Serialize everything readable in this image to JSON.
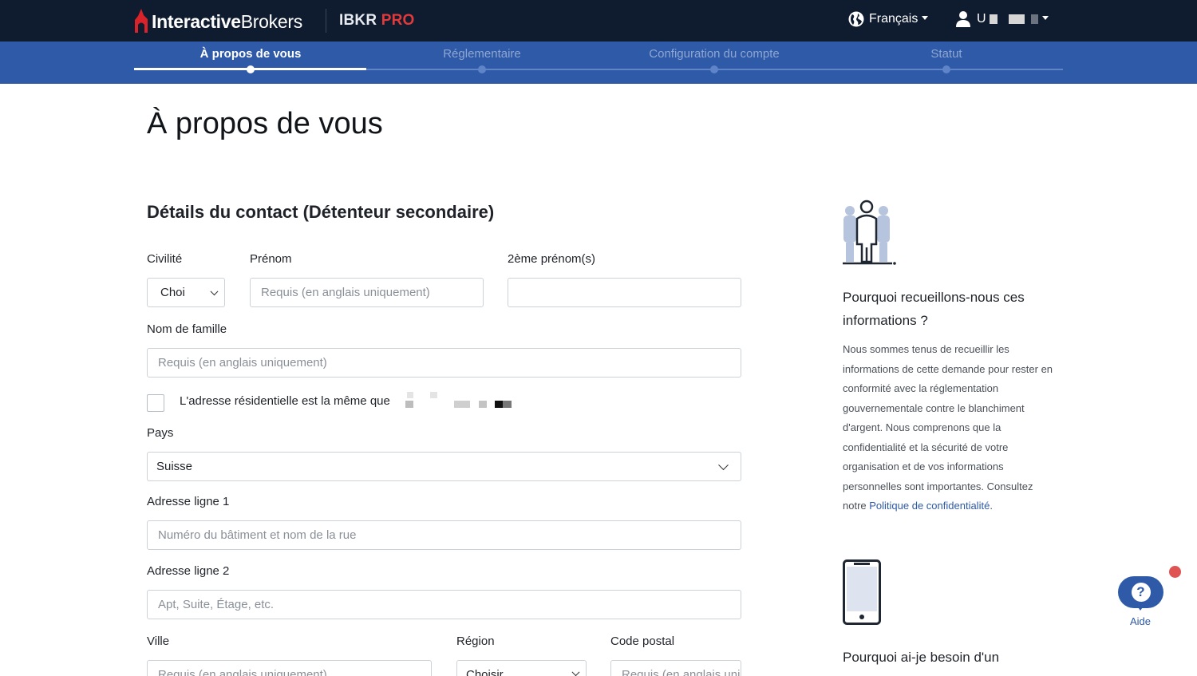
{
  "header": {
    "brand_bold": "Interactive",
    "brand_light": "Brokers",
    "product_name": "IBKR",
    "product_tier": "PRO",
    "language": "Français",
    "user_initial": "U"
  },
  "steps": [
    {
      "label": "À propos de vous",
      "active": true
    },
    {
      "label": "Réglementaire",
      "active": false
    },
    {
      "label": "Configuration du compte",
      "active": false
    },
    {
      "label": "Statut",
      "active": false
    }
  ],
  "page": {
    "title": "À propos de vous",
    "section_title": "Détails du contact (Détenteur secondaire)"
  },
  "form": {
    "civilite": {
      "label": "Civilité",
      "value": "Choi"
    },
    "prenom": {
      "label": "Prénom",
      "placeholder": "Requis (en anglais uniquement)"
    },
    "deuxieme_prenom": {
      "label": "2ème prénom(s)",
      "placeholder": ""
    },
    "nom": {
      "label": "Nom de famille",
      "placeholder": "Requis (en anglais uniquement)"
    },
    "same_address": {
      "label": "L'adresse résidentielle est la même que",
      "checked": false
    },
    "pays": {
      "label": "Pays",
      "value": "Suisse"
    },
    "adresse1": {
      "label": "Adresse ligne 1",
      "placeholder": "Numéro du bâtiment et nom de la rue"
    },
    "adresse2": {
      "label": "Adresse ligne 2",
      "placeholder": "Apt, Suite, Étage, etc."
    },
    "ville": {
      "label": "Ville",
      "placeholder": "Requis (en anglais uniquement)"
    },
    "region": {
      "label": "Région",
      "value": "Choisir"
    },
    "code_postal": {
      "label": "Code postal",
      "placeholder": "Requis (en anglais uniquement)"
    }
  },
  "sidebar": {
    "why_heading": "Pourquoi recueillons-nous ces informations ?",
    "why_text": "Nous sommes tenus de recueillir les informations de cette demande pour rester en conformité avec la réglementation gouvernementale contre le blanchiment d'argent. Nous comprenons que la confidentialité et la sécurité de votre organisation et de vos informations personnelles sont importantes. Consultez notre ",
    "why_link": "Politique de confidentialité",
    "why_end": ".",
    "phone_heading": "Pourquoi ai-je besoin d'un"
  },
  "help": {
    "label": "Aide",
    "symbol": "?"
  },
  "colors": {
    "navbar": "#0f1c2f",
    "stepper": "#2e5aa8",
    "accent_red": "#e23a3a",
    "link": "#2e5aa8"
  },
  "icons": [
    "logo-icon",
    "globe-icon",
    "user-icon",
    "people-icon",
    "phone-icon",
    "help-icon"
  ]
}
